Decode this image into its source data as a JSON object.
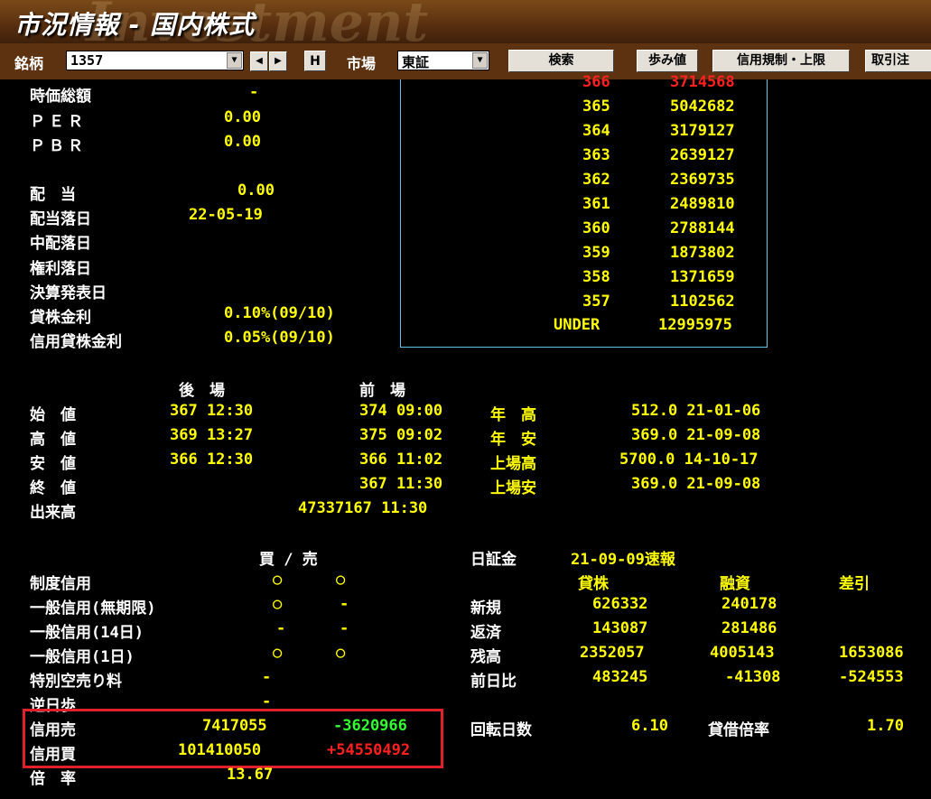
{
  "window": {
    "title": "市況情報 - 国内株式",
    "watermark": "Investment"
  },
  "toolbar": {
    "brand_label": "銘柄",
    "brand_value": "1357",
    "prev_label": "◀",
    "next_label": "▶",
    "h_label": "H",
    "market_label": "市場",
    "market_value": "東証",
    "search_label": "検索",
    "ticks_label": "歩み値",
    "margin_label": "信用規制・上限",
    "trade_label": "取引注"
  },
  "fundamentals": {
    "market_cap_label": "時価総額",
    "market_cap_value": "-",
    "per_label": "ＰＥＲ",
    "per_value": "0.00",
    "pbr_label": "ＰＢＲ",
    "pbr_value": "0.00",
    "dividend_label": "配　当",
    "dividend_value": "0.00",
    "exdiv_label": "配当落日",
    "exdiv_value": "22-05-19",
    "interim_exdiv_label": "中配落日",
    "interim_exdiv_value": "",
    "rights_label": "権利落日",
    "rights_value": "",
    "earnings_label": "決算発表日",
    "earnings_value": "",
    "lending_rate_label": "貸株金利",
    "lending_rate_value": "0.10%(09/10)",
    "margin_lending_label": "信用貸株金利",
    "margin_lending_value": "0.05%(09/10)"
  },
  "board": {
    "rows": [
      {
        "price": "366",
        "qty": "3714568",
        "color": "#ff2020"
      },
      {
        "price": "365",
        "qty": "5042682",
        "color": "#ffff00"
      },
      {
        "price": "364",
        "qty": "3179127",
        "color": "#ffff00"
      },
      {
        "price": "363",
        "qty": "2639127",
        "color": "#ffff00"
      },
      {
        "price": "362",
        "qty": "2369735",
        "color": "#ffff00"
      },
      {
        "price": "361",
        "qty": "2489810",
        "color": "#ffff00"
      },
      {
        "price": "360",
        "qty": "2788144",
        "color": "#ffff00"
      },
      {
        "price": "359",
        "qty": "1873802",
        "color": "#ffff00"
      },
      {
        "price": "358",
        "qty": "1371659",
        "color": "#ffff00"
      },
      {
        "price": "357",
        "qty": "1102562",
        "color": "#ffff00"
      }
    ],
    "under_label": "UNDER",
    "under_qty": "12995975"
  },
  "session": {
    "pm_header": "後　場",
    "am_header": "前　場",
    "open_label": "始　値",
    "open_pm": "367 12:30",
    "open_am": "374 09:00",
    "high_label": "高　値",
    "high_pm": "369 13:27",
    "high_am": "375 09:02",
    "low_label": "安　値",
    "low_pm": "366 12:30",
    "low_am": "366 11:02",
    "close_label": "終　値",
    "close_pm": "",
    "close_am": "367 11:30",
    "volume_label": "出来高",
    "volume_value": "47337167 11:30",
    "year_high_label": "年　高",
    "year_high_value": "512.0 21-01-06",
    "year_low_label": "年　安",
    "year_low_value": "369.0 21-09-08",
    "listed_high_label": "上場高",
    "listed_high_value": "5700.0 14-10-17",
    "listed_low_label": "上場安",
    "listed_low_value": "369.0 21-09-08"
  },
  "margin": {
    "buysell_header": "買 / 売",
    "system_label": "制度信用",
    "system_buy": "○",
    "system_sell": "○",
    "general_label": "一般信用(無期限)",
    "general_buy": "○",
    "general_sell": "-",
    "general14_label": "一般信用(14日)",
    "general14_buy": "-",
    "general14_sell": "-",
    "general1_label": "一般信用(1日)",
    "general1_buy": "○",
    "general1_sell": "○",
    "short_fee_label": "特別空売り料",
    "short_fee_value": "-",
    "reverse_label": "逆日歩",
    "reverse_value": "-",
    "sell_label": "信用売",
    "sell_value": "7417055",
    "sell_change": "-3620966",
    "buy_label": "信用買",
    "buy_value": "101410050",
    "buy_change": "+54550492",
    "ratio_label": "倍　率",
    "ratio_value": "13.67"
  },
  "jsf": {
    "label": "日証金",
    "date": "21-09-09速報",
    "col_lend": "貸株",
    "col_loan": "融資",
    "col_diff": "差引",
    "new_label": "新規",
    "new_lend": "626332",
    "new_loan": "240178",
    "new_diff": "",
    "repay_label": "返済",
    "repay_lend": "143087",
    "repay_loan": "281486",
    "repay_diff": "",
    "balance_label": "残高",
    "balance_lend": "2352057",
    "balance_loan": "4005143",
    "balance_diff": "1653086",
    "prev_label": "前日比",
    "prev_lend": "483245",
    "prev_loan": "-41308",
    "prev_diff": "-524553",
    "turnover_label": "回転日数",
    "turnover_value": "6.10",
    "ratio_label": "貸借倍率",
    "ratio_value": "1.70"
  },
  "colors": {
    "label": "#ffffff",
    "value": "#ffff00",
    "up": "#ff2020",
    "down": "#33ff33",
    "board_border": "#5fc8e8",
    "highlight": "#e0202a"
  }
}
